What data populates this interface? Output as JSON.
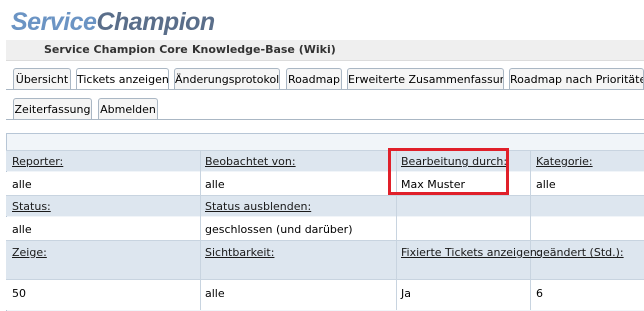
{
  "logo": {
    "part1": "Service",
    "part2": "Champion"
  },
  "project_bar": {
    "project": "Service Champion Core",
    "subtitle": "Knowledge-Base (Wiki)"
  },
  "tabs": [
    {
      "label": "Übersicht"
    },
    {
      "label": "Tickets anzeigen",
      "active": true
    },
    {
      "label": "Änderungsprotokoll"
    },
    {
      "label": "Roadmap"
    },
    {
      "label": "Erweiterte Zusammenfassung"
    },
    {
      "label": "Roadmap nach Prioritäten"
    },
    {
      "label": "Zeiterfassung"
    },
    {
      "label": "Abmelden"
    }
  ],
  "filters": {
    "reporter": {
      "label": "Reporter:",
      "value": "alle"
    },
    "beobachtet": {
      "label": "Beobachtet von:",
      "value": "alle"
    },
    "bearbeitung": {
      "label": "Bearbeitung durch:",
      "value": "Max Muster"
    },
    "kategorie": {
      "label": "Kategorie:",
      "value": "alle"
    },
    "status": {
      "label": "Status:",
      "value": "alle"
    },
    "status_ausblenden": {
      "label": "Status ausblenden:",
      "value": "geschlossen (und darüber)"
    },
    "zeige": {
      "label": "Zeige:",
      "value": "50"
    },
    "sichtbarkeit": {
      "label": "Sichtbarkeit:",
      "value": "alle"
    },
    "fixierte": {
      "label": "Fixierte Tickets anzeigen:",
      "value": "Ja"
    },
    "geaendert": {
      "label": "geändert (Std.):",
      "value": "6"
    }
  },
  "colors": {
    "highlight_box": "#e0202a",
    "logo_light": "#6b94c4",
    "logo_dark": "#5a6e8a"
  }
}
